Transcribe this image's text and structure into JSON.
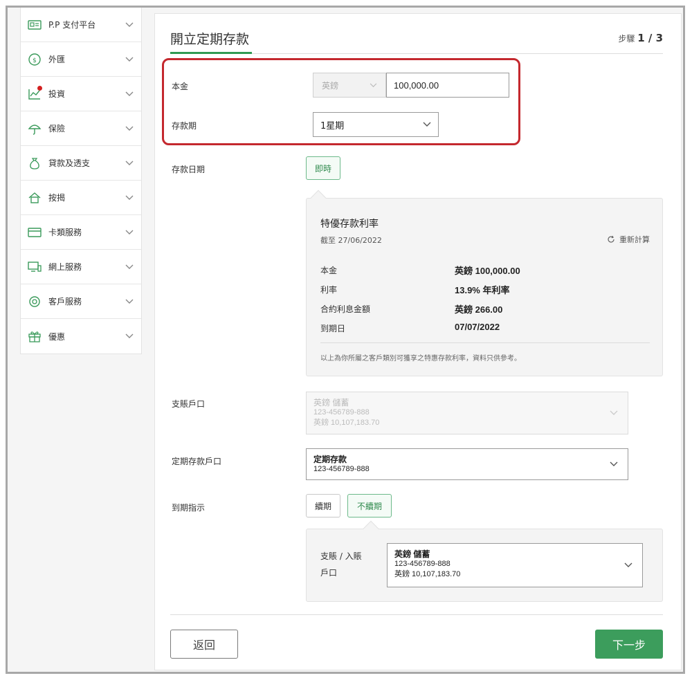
{
  "sidebar": {
    "items": [
      {
        "label": "P.P 支付平台",
        "icon": "pp-payment-icon"
      },
      {
        "label": "外匯",
        "icon": "fx-exchange-icon"
      },
      {
        "label": "投資",
        "icon": "investment-chart-icon",
        "badge_color": "#d32020"
      },
      {
        "label": "保險",
        "icon": "umbrella-icon"
      },
      {
        "label": "貸款及透支",
        "icon": "money-bag-icon"
      },
      {
        "label": "按揭",
        "icon": "house-icon"
      },
      {
        "label": "卡類服務",
        "icon": "card-icon"
      },
      {
        "label": "網上服務",
        "icon": "computer-icon"
      },
      {
        "label": "客戶服務",
        "icon": "headset-icon"
      },
      {
        "label": "優惠",
        "icon": "gift-icon"
      }
    ]
  },
  "header": {
    "title": "開立定期存款",
    "step_prefix": "步驟",
    "step_value": "1 / 3"
  },
  "form": {
    "principal_label": "本金",
    "currency_value": "英鎊",
    "amount_value": "100,000.00",
    "period_label": "存款期",
    "period_value": "1星期",
    "date_label": "存款日期",
    "date_option": "即時",
    "debit_label": "支賬戶口",
    "debit_account": {
      "line1": "英鎊 儲蓄",
      "line2": "123-456789-888",
      "line3": "英鎊 10,107,183.70"
    },
    "td_account_label": "定期存款戶口",
    "td_account": {
      "line1": "定期存款",
      "line2": "123-456789-888"
    },
    "maturity_label": "到期指示",
    "maturity_options": [
      "續期",
      "不續期"
    ],
    "maturity_selected": "不續期",
    "credit_label_1": "支賬 / 入賬",
    "credit_label_2": "戶口",
    "credit_account": {
      "line1": "英鎊 儲蓄",
      "line2": "123-456789-888",
      "line3": "英鎊 10,107,183.70"
    }
  },
  "rate_box": {
    "title": "特優存款利率",
    "as_of": "截至 27/06/2022",
    "recalc": "重新計算",
    "rows": [
      {
        "label": "本金",
        "value": "英鎊 100,000.00"
      },
      {
        "label": "利率",
        "value": "13.9% 年利率"
      },
      {
        "label": "合約利息金額",
        "value": "英鎊 266.00"
      },
      {
        "label": "到期日",
        "value": "07/07/2022"
      }
    ],
    "note": "以上為你所屬之客戶類別可獲享之特惠存款利率，資料只供參考。"
  },
  "footer": {
    "back_label": "返回",
    "next_label": "下一步"
  },
  "colors": {
    "accent": "#2f9a53",
    "next_button": "#3c9d5c",
    "highlight": "#c4282e"
  }
}
